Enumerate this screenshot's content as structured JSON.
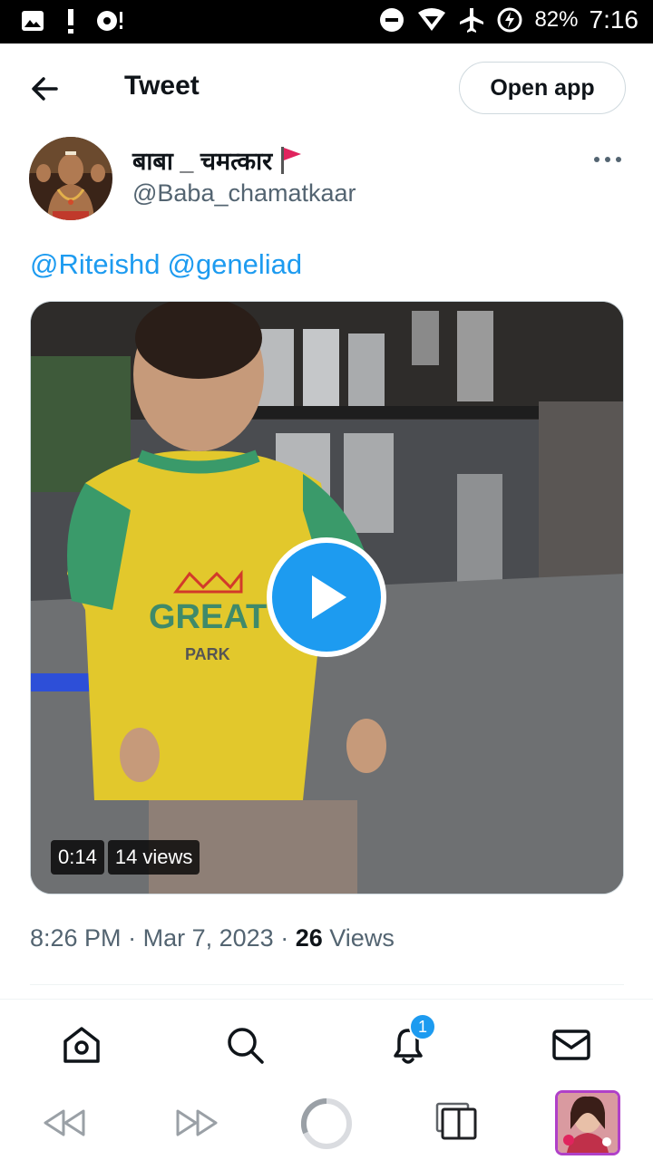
{
  "status_bar": {
    "battery": "82%",
    "time": "7:16",
    "icons": [
      "image-icon",
      "alert-icon",
      "cast-icon",
      "dnd-icon",
      "wifi-icon",
      "airplane-icon",
      "battery-charging-icon"
    ]
  },
  "header": {
    "title": "Tweet",
    "open_app_label": "Open app"
  },
  "author": {
    "name": "बाबा _ चमत्कार",
    "handle": "@Baba_chamatkaar",
    "flag_color": "#e0245e"
  },
  "tweet": {
    "mentions": [
      "@Riteishd",
      "@geneliad"
    ],
    "video_duration": "0:14",
    "video_views": "14 views",
    "time": "8:26 PM",
    "date": "Mar 7, 2023",
    "separator": "·",
    "views_count": "26",
    "views_label": "Views"
  },
  "bottom_nav": {
    "items": [
      "home-icon",
      "search-icon",
      "notifications-icon",
      "messages-icon"
    ],
    "notification_count": "1"
  },
  "browser_bar": {
    "items": [
      "back-icon",
      "forward-icon",
      "reload-icon",
      "tabs-icon",
      "tab-thumbnail"
    ]
  },
  "colors": {
    "accent": "#1d9bf0",
    "text_primary": "#0f1419",
    "text_secondary": "#536471",
    "border": "#cfd9de"
  }
}
